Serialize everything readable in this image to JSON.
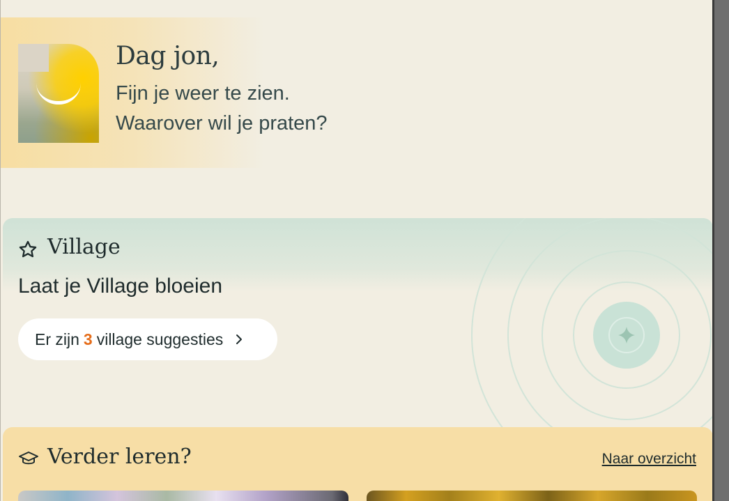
{
  "greeting": {
    "title": "Dag jon,",
    "line1": "Fijn je weer te zien.",
    "line2": "Waarover wil je praten?"
  },
  "village": {
    "title": "Village",
    "subtitle": "Laat je Village bloeien",
    "suggestion_prefix": "Er zijn",
    "suggestion_count": "3",
    "suggestion_suffix": "village suggesties"
  },
  "learn": {
    "title": "Verder leren?",
    "overview_link": "Naar overzicht"
  },
  "icons": {
    "village": "star-icon",
    "learn": "graduation-cap-icon",
    "pill_arrow": "chevron-right-icon",
    "rings_center": "sparkle-icon"
  },
  "colors": {
    "background": "#f2eee2",
    "greeting_accent": "#f7dea2",
    "village_accent": "#cfe2d6",
    "learn_card": "#f7dea6",
    "highlight_number": "#e56d1b",
    "text": "#1e2b2c"
  }
}
